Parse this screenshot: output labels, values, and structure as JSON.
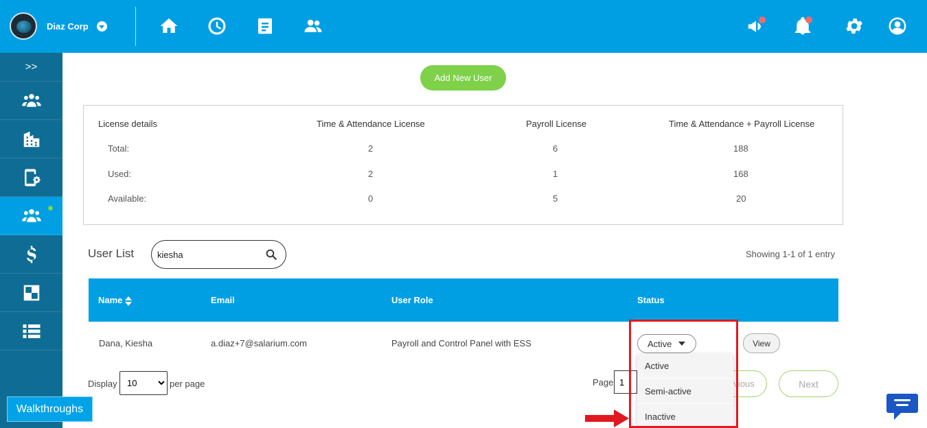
{
  "header": {
    "company_name": "Diaz Corp",
    "nav_icons": [
      "home-icon",
      "clock-icon",
      "document-icon",
      "people-icon"
    ],
    "right_icons": [
      "megaphone-icon",
      "bell-icon",
      "gear-icon",
      "user-profile-icon"
    ],
    "accent_color": "#009fe3",
    "notification_color": "#f26b6b"
  },
  "sidebar": {
    "expand_label": ">>",
    "items": [
      {
        "icon": "users-group-icon"
      },
      {
        "icon": "building-icon"
      },
      {
        "icon": "device-settings-icon"
      },
      {
        "icon": "users-icon",
        "active": true
      },
      {
        "icon": "dollar-icon"
      },
      {
        "icon": "control-panel-icon"
      },
      {
        "icon": "list-icon"
      }
    ],
    "color": "#0f6d95"
  },
  "main": {
    "add_user_label": "Add New User",
    "license": {
      "headers": [
        "License details",
        "Time & Attendance License",
        "Payroll License",
        "Time & Attendance + Payroll License"
      ],
      "rows": [
        {
          "label": "Total:",
          "values": [
            "2",
            "6",
            "188"
          ]
        },
        {
          "label": "Used:",
          "values": [
            "2",
            "1",
            "168"
          ]
        },
        {
          "label": "Available:",
          "values": [
            "0",
            "5",
            "20"
          ]
        }
      ]
    },
    "user_list": {
      "title": "User List",
      "search_value": "kiesha",
      "showing": "Showing 1-1 of 1 entry",
      "columns": [
        "Name",
        "Email",
        "User Role",
        "Status"
      ],
      "rows": [
        {
          "name": "Dana, Kiesha",
          "email": "a.diaz+7@salarium.com",
          "role": "Payroll and Control Panel with ESS",
          "status": "Active",
          "action": "View"
        }
      ],
      "status_options": [
        "Active",
        "Semi-active",
        "Inactive"
      ]
    },
    "pagination": {
      "display_label": "Display",
      "display_value": "10",
      "per_page_label": "per page",
      "page_label": "Page",
      "page_value": "1",
      "previous_label": "Previous",
      "next_label": "Next"
    }
  },
  "walkthroughs_label": "Walkthroughs"
}
